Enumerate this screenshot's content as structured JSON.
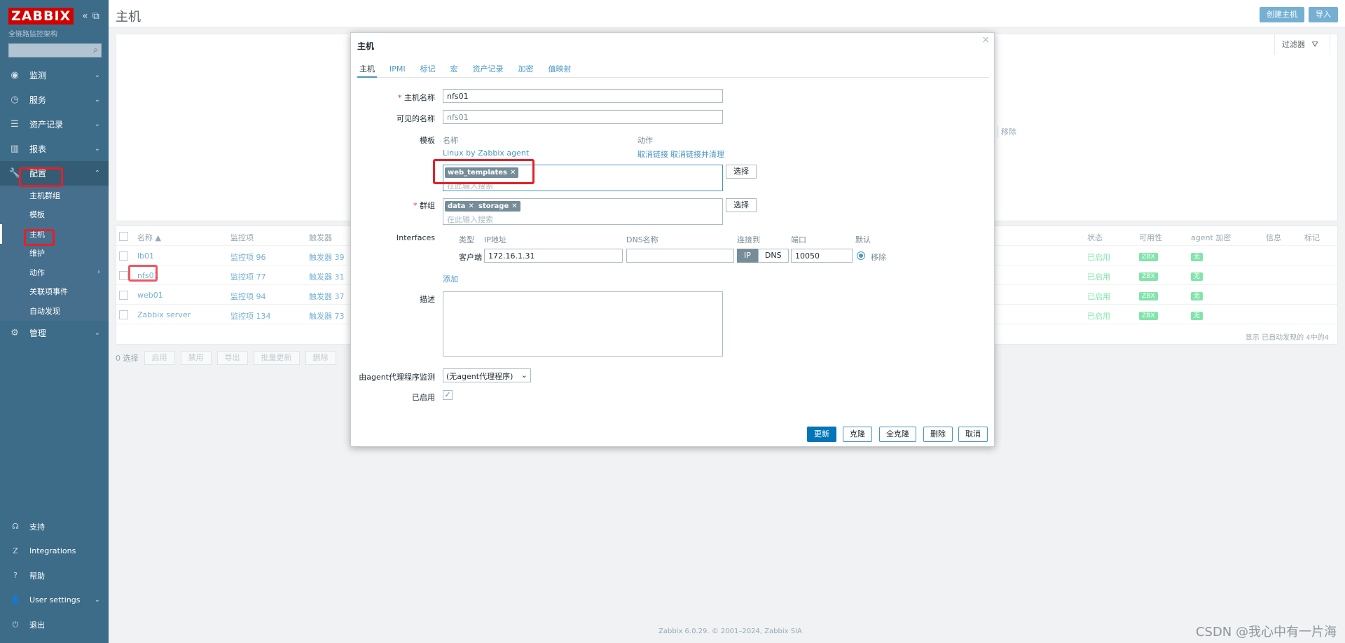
{
  "app": {
    "logo": "ZABBIX",
    "subtitle": "全链路监控架构",
    "search_placeholder": ""
  },
  "sidebar": {
    "menu": [
      {
        "label": "监测",
        "icon": "eye-icon"
      },
      {
        "label": "服务",
        "icon": "clock-icon"
      },
      {
        "label": "资产记录",
        "icon": "list-icon"
      },
      {
        "label": "报表",
        "icon": "chart-icon"
      },
      {
        "label": "配置",
        "icon": "wrench-icon"
      }
    ],
    "config_submenu": [
      "主机群组",
      "模板",
      "主机",
      "维护",
      "动作",
      "关联项事件",
      "自动发现"
    ],
    "admin": {
      "label": "管理",
      "icon": "gear-icon"
    },
    "bottom": [
      {
        "label": "支持",
        "icon": "headset-icon"
      },
      {
        "label": "Integrations",
        "icon": "z-icon"
      },
      {
        "label": "帮助",
        "icon": "question-icon"
      },
      {
        "label": "User settings",
        "icon": "user-icon"
      },
      {
        "label": "退出",
        "icon": "power-icon"
      }
    ]
  },
  "header": {
    "title": "主机",
    "create_host": "创建主机",
    "import": "导入",
    "filter": "过滤器",
    "remove": "移除"
  },
  "hosts_table": {
    "columns": [
      "名称 ▲",
      "监控项",
      "触发器",
      "状态",
      "可用性",
      "agent 加密",
      "信息",
      "标记"
    ],
    "rows": [
      {
        "name": "lb01",
        "items": "监控项 96",
        "triggers": "触发器 39",
        "status": "已启用",
        "availability": "ZBX",
        "encryption": "无"
      },
      {
        "name": "nfs01",
        "items": "监控项 77",
        "triggers": "触发器 31",
        "status": "已启用",
        "availability": "ZBX",
        "encryption": "无"
      },
      {
        "name": "web01",
        "items": "监控项 94",
        "triggers": "触发器 37",
        "status": "已启用",
        "availability": "ZBX",
        "encryption": "无"
      },
      {
        "name": "Zabbix server",
        "items": "监控项 134",
        "triggers": "触发器 73",
        "status": "已启用",
        "availability": "ZBX",
        "encryption": "无"
      }
    ],
    "footer": "显示 已自动发现的 4中的4",
    "mass": {
      "selected": "0 选择",
      "buttons": [
        "启用",
        "禁用",
        "导出",
        "批量更新",
        "删除"
      ]
    }
  },
  "modal": {
    "title": "主机",
    "tabs": [
      "主机",
      "IPMI",
      "标记",
      "宏",
      "资产记录",
      "加密",
      "值映射"
    ],
    "host_name_label": "主机名称",
    "host_name": "nfs01",
    "visible_name_label": "可见的名称",
    "visible_name": "nfs01",
    "templates_label": "模板",
    "templates_col_name": "名称",
    "templates_col_action": "动作",
    "linked_template": "Linux by Zabbix agent",
    "unlink": "取消链接",
    "unlink_clear": "取消链接并清理",
    "new_template_chip": "web_templates",
    "search_placeholder": "在此输入搜索",
    "select_button": "选择",
    "groups_label": "群组",
    "groups": [
      "data",
      "storage"
    ],
    "interfaces_label": "Interfaces",
    "if_cols": {
      "type": "类型",
      "ip": "IP地址",
      "dns": "DNS名称",
      "connect": "连接到",
      "port": "端口",
      "default": "默认"
    },
    "if_row": {
      "type": "客户端",
      "ip": "172.16.1.31",
      "dns": "",
      "ip_btn": "IP",
      "dns_btn": "DNS",
      "port": "10050",
      "remove": "移除"
    },
    "add": "添加",
    "description_label": "描述",
    "proxy_label": "由agent代理程序监测",
    "proxy_value": "(无agent代理程序)",
    "enabled_label": "已启用",
    "buttons": {
      "update": "更新",
      "clone": "克隆",
      "full_clone": "全克隆",
      "delete": "删除",
      "cancel": "取消"
    }
  },
  "footer": {
    "copyright": "Zabbix 6.0.29. © 2001–2024, Zabbix SIA",
    "watermark": "CSDN @我心中有一片海"
  },
  "colors": {
    "sidebar": "#3d6c88",
    "logo_red": "#d40000",
    "accent": "#4796c4",
    "highlight_box": "#e4202b",
    "enabled_green": "#59db8f"
  }
}
